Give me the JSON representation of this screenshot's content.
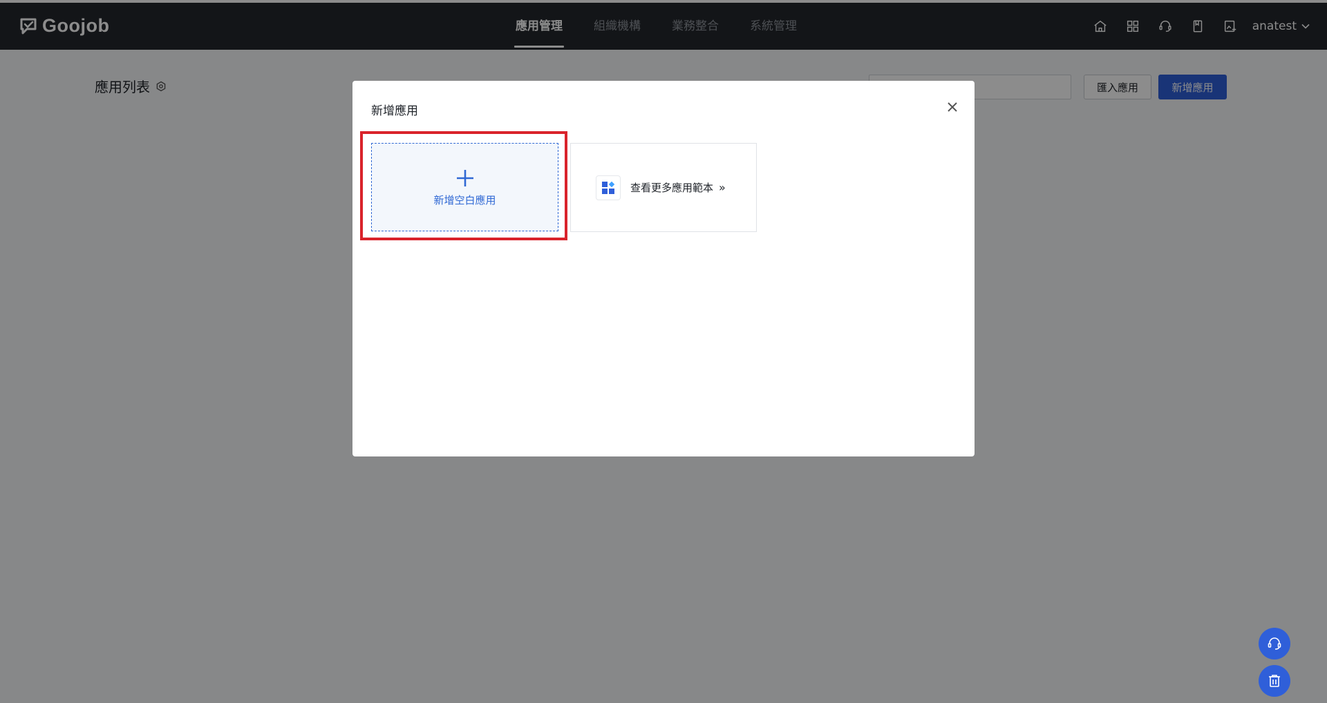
{
  "header": {
    "brand": "Goojob",
    "nav": [
      {
        "label": "應用管理",
        "active": true
      },
      {
        "label": "組織機構",
        "active": false
      },
      {
        "label": "業務整合",
        "active": false
      },
      {
        "label": "系統管理",
        "active": false
      }
    ],
    "icons": [
      "home-icon",
      "apps-grid-icon",
      "support-icon",
      "document-icon",
      "edit-image-icon"
    ],
    "user": "anatest"
  },
  "page": {
    "title": "應用列表",
    "search_value": "",
    "import_button": "匯入應用",
    "add_button": "新增應用"
  },
  "modal": {
    "title": "新增應用",
    "blank_card_label": "新增空白應用",
    "template_card_label": "查看更多應用範本",
    "template_card_arrow": "»"
  },
  "colors": {
    "header_bg": "#24272c",
    "accent": "#2f5fd9",
    "highlight": "#d9232b"
  }
}
